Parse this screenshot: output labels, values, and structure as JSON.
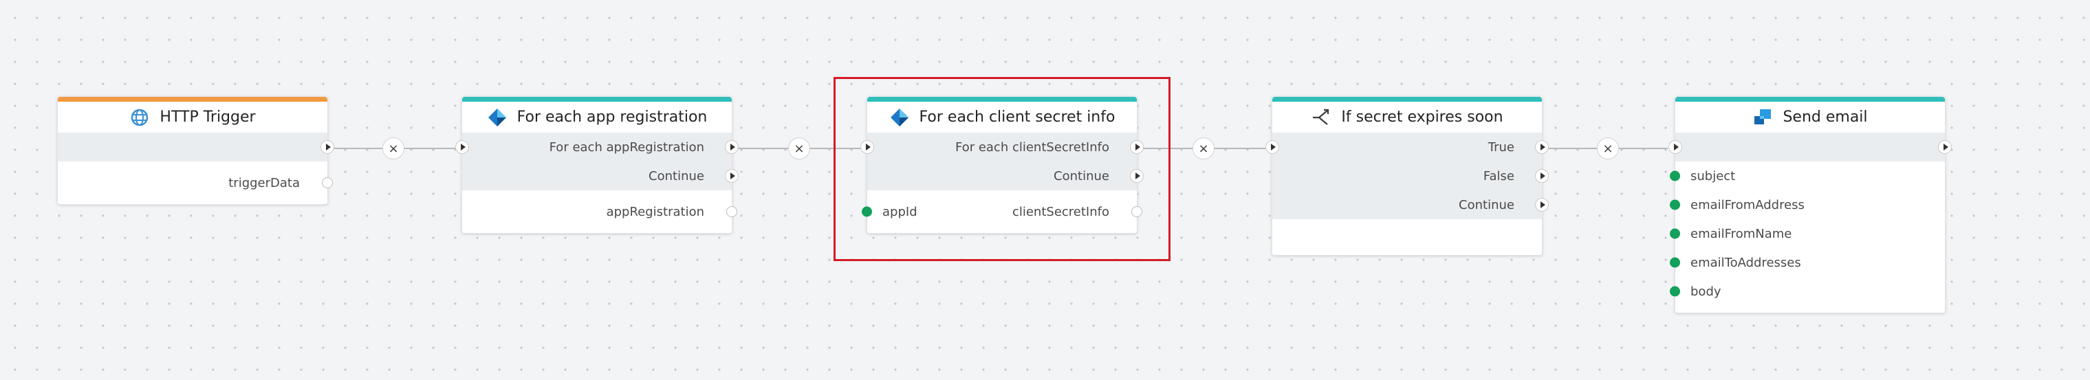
{
  "nodes": {
    "http_trigger": {
      "title": "HTTP Trigger",
      "accent": "#f29a3f",
      "icon": "globe-icon",
      "outputs": [
        "triggerData"
      ]
    },
    "for_each_app": {
      "title": "For each app registration",
      "accent": "#2ebfbc",
      "icon": "azure-icon",
      "flow_outputs": [
        "For each appRegistration",
        "Continue"
      ],
      "outputs": [
        "appRegistration"
      ]
    },
    "for_each_secret": {
      "title": "For each client secret info",
      "accent": "#2ebfbc",
      "icon": "azure-icon",
      "flow_outputs": [
        "For each clientSecretInfo",
        "Continue"
      ],
      "inputs": [
        "appId"
      ],
      "outputs": [
        "clientSecretInfo"
      ],
      "selected": true
    },
    "if_expires": {
      "title": "If secret expires soon",
      "accent": "#2ebfbc",
      "icon": "branch-icon",
      "flow_outputs": [
        "True",
        "False",
        "Continue"
      ]
    },
    "send_email": {
      "title": "Send email",
      "accent": "#2ebfbc",
      "icon": "email-icon",
      "inputs": [
        "subject",
        "emailFromAddress",
        "emailFromName",
        "emailToAddresses",
        "body"
      ]
    }
  },
  "connectors": {
    "remove_symbol": "×"
  },
  "colors": {
    "selection": "#d41b25",
    "input_pin": "#13a05a",
    "accent_teal": "#2ebfbc",
    "accent_orange": "#f29a3f"
  }
}
